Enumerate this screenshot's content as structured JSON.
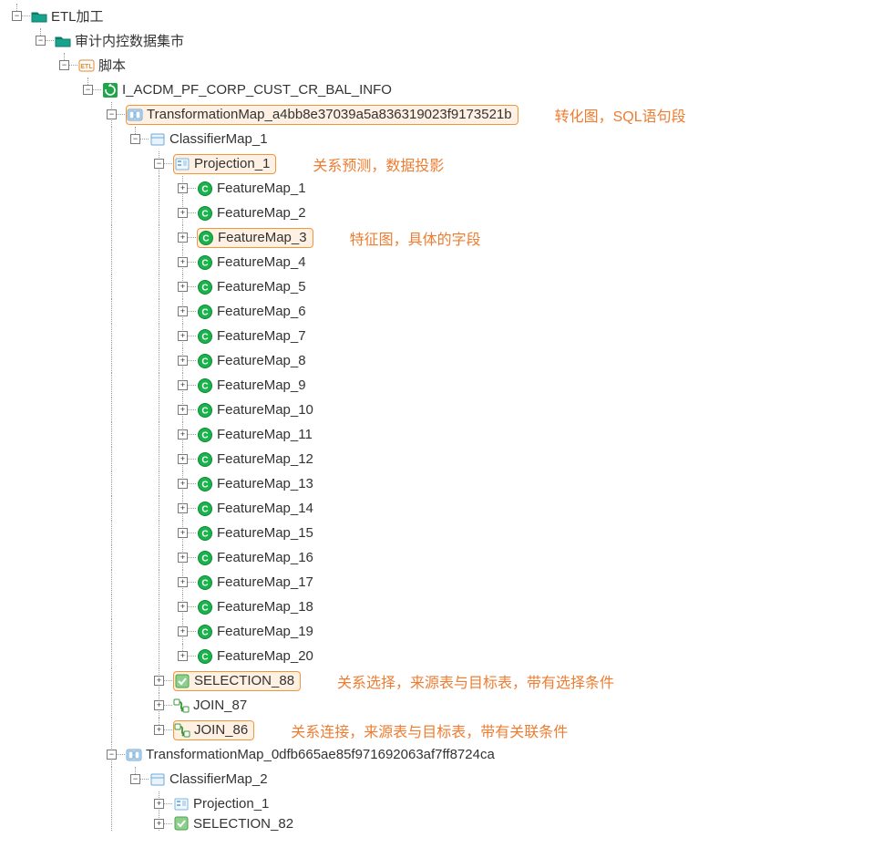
{
  "nodes": {
    "root": {
      "label": "ETL加工"
    },
    "mart": {
      "label": "审计内控数据集市"
    },
    "script": {
      "label": "脚本"
    },
    "job": {
      "label": "I_ACDM_PF_CORP_CUST_CR_BAL_INFO"
    },
    "tm1": {
      "label": "TransformationMap_a4bb8e37039a5a836319023f9173521b"
    },
    "cm1": {
      "label": "ClassifierMap_1"
    },
    "proj1": {
      "label": "Projection_1"
    },
    "features": [
      "FeatureMap_1",
      "FeatureMap_2",
      "FeatureMap_3",
      "FeatureMap_4",
      "FeatureMap_5",
      "FeatureMap_6",
      "FeatureMap_7",
      "FeatureMap_8",
      "FeatureMap_9",
      "FeatureMap_10",
      "FeatureMap_11",
      "FeatureMap_12",
      "FeatureMap_13",
      "FeatureMap_14",
      "FeatureMap_15",
      "FeatureMap_16",
      "FeatureMap_17",
      "FeatureMap_18",
      "FeatureMap_19",
      "FeatureMap_20"
    ],
    "sel88": {
      "label": "SELECTION_88"
    },
    "join87": {
      "label": "JOIN_87"
    },
    "join86": {
      "label": "JOIN_86"
    },
    "tm2": {
      "label": "TransformationMap_0dfb665ae85f971692063af7ff8724ca"
    },
    "cm2": {
      "label": "ClassifierMap_2"
    },
    "proj2": {
      "label": "Projection_1"
    },
    "sel82": {
      "label": "SELECTION_82"
    }
  },
  "annotations": {
    "tm1": "转化图，SQL语句段",
    "proj1": "关系预测，数据投影",
    "feat3": "特征图，具体的字段",
    "sel88": "关系选择，来源表与目标表，带有选择条件",
    "join86": "关系连接，来源表与目标表，带有关联条件"
  },
  "toggles": {
    "minus": "−",
    "plus": "+"
  }
}
